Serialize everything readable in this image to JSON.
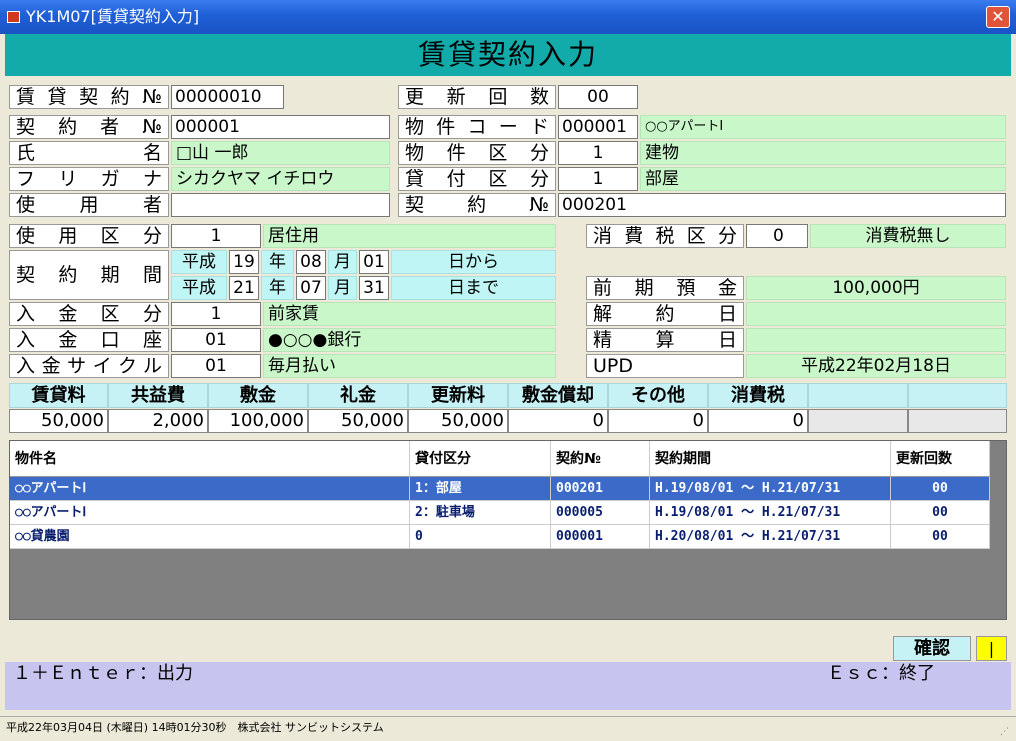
{
  "window": {
    "title": "YK1M07[賃貸契約入力]",
    "close_glyph": "✕"
  },
  "header": {
    "title": "賃貸契約入力"
  },
  "contract": {
    "no_label": "賃貸契約№",
    "no_value": "00000010",
    "renew_label": "更新回数",
    "renew_value": "00",
    "tenant_no_label": "契約者№",
    "tenant_no_value": "000001",
    "name_label": "氏名",
    "name_value": "□山 一郎",
    "kana_label": "フリガナ",
    "kana_value": "シカクヤマ イチロウ",
    "user_label": "使用者",
    "user_value": "",
    "prop_code_label": "物件コード",
    "prop_code_value": "000001",
    "prop_name": "○○アパートⅠ",
    "prop_kbn_label": "物件区分",
    "prop_kbn_value": "1",
    "prop_kbn_name": "建物",
    "lend_kbn_label": "貸付区分",
    "lend_kbn_value": "1",
    "lend_kbn_name": "部屋",
    "keiyaku_no_label": "契約№",
    "keiyaku_no_value": "000201",
    "use_kbn_label": "使用区分",
    "use_kbn_value": "1",
    "use_kbn_name": "居住用",
    "period_label": "契約期間",
    "period_from": {
      "era": "平成",
      "y": "19",
      "ylbl": "年",
      "m": "08",
      "mlbl": "月",
      "d": "01",
      "suffix": "日から"
    },
    "period_to": {
      "era": "平成",
      "y": "21",
      "ylbl": "年",
      "m": "07",
      "mlbl": "月",
      "d": "31",
      "suffix": "日まで"
    },
    "pay_kbn_label": "入金区分",
    "pay_kbn_value": "1",
    "pay_kbn_name": "前家賃",
    "pay_acct_label": "入金口座",
    "pay_acct_value": "01",
    "pay_acct_name": "●○○●銀行",
    "pay_cycle_label": "入金サイクル",
    "pay_cycle_value": "01",
    "pay_cycle_name": "毎月払い",
    "tax_kbn_label": "消費税区分",
    "tax_kbn_value": "0",
    "tax_kbn_name": "消費税無し",
    "prepaid_label": "前期預金",
    "prepaid_value": "100,000円",
    "cancel_label": "解約日",
    "cancel_value": "",
    "settle_label": "精算日",
    "settle_value": "",
    "upd_label": "UPD",
    "upd_value": "平成22年02月18日"
  },
  "fees": {
    "headers": [
      "賃貸料",
      "共益費",
      "敷金",
      "礼金",
      "更新料",
      "敷金償却",
      "その他",
      "消費税",
      "",
      ""
    ],
    "values": [
      "50,000",
      "2,000",
      "100,000",
      "50,000",
      "50,000",
      "0",
      "0",
      "0",
      "",
      ""
    ]
  },
  "grid": {
    "columns": [
      "物件名",
      "貸付区分",
      "契約№",
      "契約期間",
      "更新回数"
    ],
    "rows": [
      [
        "○○アパートⅠ",
        "1：部屋",
        "000201",
        "H.19/08/01 ～ H.21/07/31",
        "00"
      ],
      [
        "○○アパートⅠ",
        "2：駐車場",
        "000005",
        "H.19/08/01 ～ H.21/07/31",
        "00"
      ],
      [
        "○○貸農園",
        "0",
        "000001",
        "H.20/08/01 ～ H.21/07/31",
        "00"
      ]
    ]
  },
  "confirm": {
    "label": "確認",
    "value": "|"
  },
  "funcbar": {
    "left": "１＋Ｅｎｔｅｒ：出力",
    "right": "Ｅｓｃ：終了"
  },
  "status": {
    "text": "平成22年03月04日 (木曜日) 14時01分30秒　株式会社 サンビットシステム"
  },
  "colors": {
    "header": "#13aaaa",
    "selected_row": "#3b6ac9",
    "funcbar": "#c8c4f0"
  }
}
